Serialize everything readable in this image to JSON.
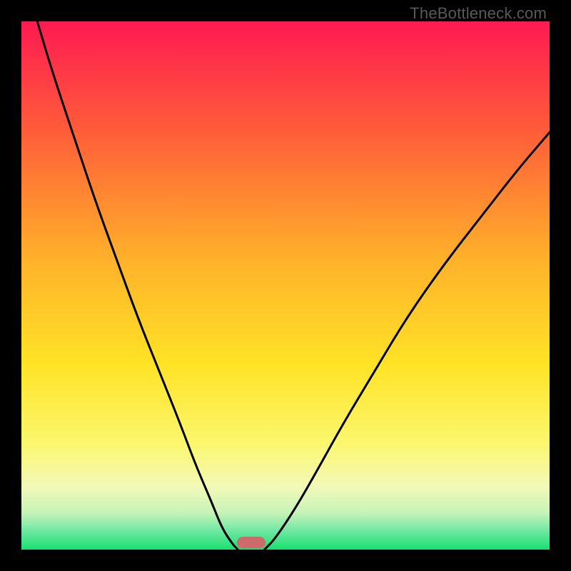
{
  "watermark": "TheBottleneck.com",
  "chart_data": {
    "type": "line",
    "title": "",
    "xlabel": "",
    "ylabel": "",
    "xlim": [
      0,
      100
    ],
    "ylim": [
      0,
      100
    ],
    "grid": false,
    "legend": false,
    "background_gradient_stops": [
      {
        "offset": 0,
        "color": "#ff1a52"
      },
      {
        "offset": 20,
        "color": "#ff5a3a"
      },
      {
        "offset": 45,
        "color": "#ffb12a"
      },
      {
        "offset": 65,
        "color": "#ffe326"
      },
      {
        "offset": 80,
        "color": "#fbf76e"
      },
      {
        "offset": 88,
        "color": "#f3f9b8"
      },
      {
        "offset": 93,
        "color": "#c7f3b8"
      },
      {
        "offset": 96.5,
        "color": "#6de8a3"
      },
      {
        "offset": 100,
        "color": "#18e06f"
      }
    ],
    "series": [
      {
        "name": "left-curve",
        "stroke": "#000000",
        "x": [
          3,
          6,
          10,
          14,
          18,
          22,
          26,
          30,
          33,
          36,
          38,
          40,
          41
        ],
        "y": [
          100,
          90,
          78,
          66,
          55,
          44,
          34,
          24,
          16,
          9,
          4,
          1,
          0
        ]
      },
      {
        "name": "right-curve",
        "stroke": "#000000",
        "x": [
          46,
          48,
          52,
          56,
          61,
          67,
          73,
          80,
          87,
          94,
          100
        ],
        "y": [
          0,
          2,
          8,
          15,
          24,
          34,
          44,
          54,
          63,
          72,
          79
        ]
      }
    ],
    "minimum_marker": {
      "x_center": 43.5,
      "width": 5.5,
      "height": 2.2,
      "color": "#cf6a6c"
    }
  }
}
